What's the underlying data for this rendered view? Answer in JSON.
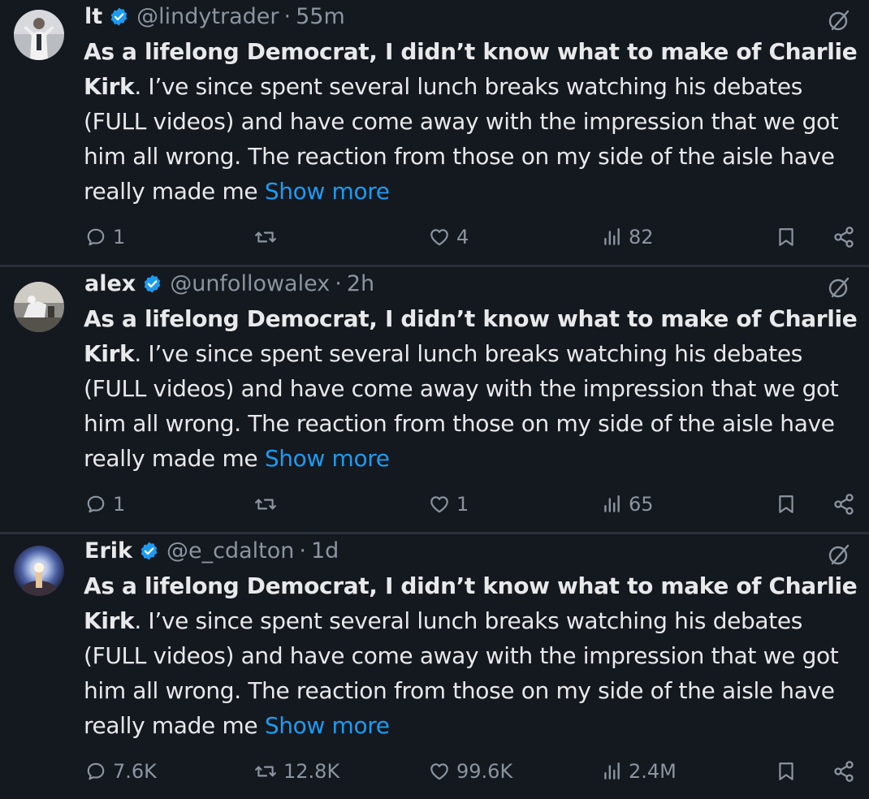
{
  "tweets": [
    {
      "name": "lt",
      "handle": "@lindytrader",
      "separator": "·",
      "time": "55m",
      "text_bold": "As a lifelong Democrat, I didn’t know what to make of Charlie Kirk",
      "text_rest": ". I’ve since spent several lunch breaks watching his debates (FULL videos) and have come away with the impression that we got him all wrong. The reaction from those on my side of the aisle have really made me",
      "show_more": "Show more",
      "replies": "1",
      "retweets": "",
      "likes": "4",
      "views": "82"
    },
    {
      "name": "alex",
      "handle": "@unfollowalex",
      "separator": "·",
      "time": "2h",
      "text_bold": "As a lifelong Democrat, I didn’t know what to make of Charlie Kirk",
      "text_rest": ". I’ve since spent several lunch breaks watching his debates (FULL videos) and have come away with the impression that we got him all wrong. The reaction from those on my side of the aisle have really made me",
      "show_more": "Show more",
      "replies": "1",
      "retweets": "",
      "likes": "1",
      "views": "65"
    },
    {
      "name": "Erik",
      "handle": "@e_cdalton",
      "separator": "·",
      "time": "1d",
      "text_bold": "As a lifelong Democrat, I didn’t know what to make of Charlie Kirk",
      "text_rest": ". I’ve since spent several lunch breaks watching his debates (FULL videos) and have come away with the impression that we got him all wrong. The reaction from those on my side of the aisle have really made me",
      "show_more": "Show more",
      "replies": "7.6K",
      "retweets": "12.8K",
      "likes": "99.6K",
      "views": "2.4M"
    }
  ],
  "icons": {
    "verified": "verified-badge-icon",
    "grok": "grok-icon",
    "reply": "reply-icon",
    "retweet": "retweet-icon",
    "like": "heart-icon",
    "views": "views-icon",
    "bookmark": "bookmark-icon",
    "share": "share-icon"
  },
  "colors": {
    "background": "#14181f",
    "text": "#e7e9ea",
    "muted": "#8b95a0",
    "link": "#1d9bf0",
    "verified": "#1d9bf0"
  }
}
